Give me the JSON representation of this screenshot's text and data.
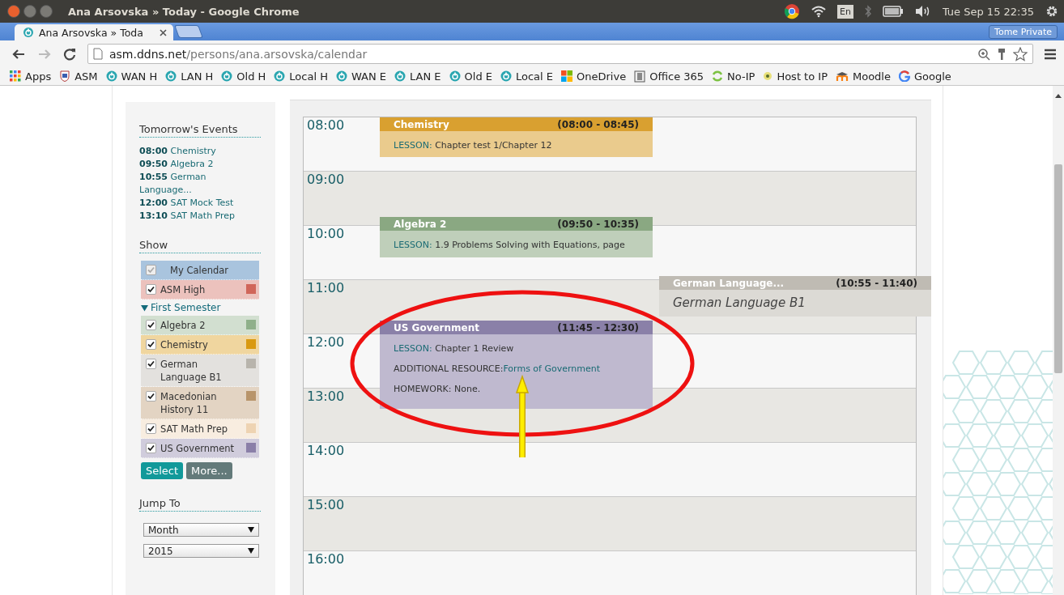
{
  "window": {
    "title": "Ana Arsovska » Today - Google Chrome"
  },
  "tray": {
    "keyboard_layout": "En",
    "clock": "Tue Sep 15 22:35"
  },
  "tabs": [
    {
      "label": "Ana Arsovska » Toda",
      "selected": true
    }
  ],
  "profile_button": "Tome Private",
  "address_bar": {
    "host": "asm.ddns.net",
    "path": "/persons/ana.arsovska/calendar"
  },
  "bookmarks": [
    {
      "label": "Apps",
      "kind": "grid"
    },
    {
      "label": "ASM",
      "kind": "crest"
    },
    {
      "label": "WAN H",
      "kind": "ring"
    },
    {
      "label": "LAN H",
      "kind": "ring"
    },
    {
      "label": "Old H",
      "kind": "ring"
    },
    {
      "label": "Local H",
      "kind": "ring"
    },
    {
      "label": "WAN E",
      "kind": "ring"
    },
    {
      "label": "LAN E",
      "kind": "ring"
    },
    {
      "label": "Old E",
      "kind": "ring"
    },
    {
      "label": "Local E",
      "kind": "ring"
    },
    {
      "label": "OneDrive",
      "kind": "windows"
    },
    {
      "label": "Office 365",
      "kind": "office"
    },
    {
      "label": "No-IP",
      "kind": "sync"
    },
    {
      "label": "Host to IP",
      "kind": "bulb"
    },
    {
      "label": "Moodle",
      "kind": "moodle"
    },
    {
      "label": "Google",
      "kind": "google"
    }
  ],
  "sidebar": {
    "tomorrow": {
      "heading": "Tomorrow's Events",
      "events": [
        {
          "time": "08:00",
          "title": "Chemistry"
        },
        {
          "time": "09:50",
          "title": "Algebra 2"
        },
        {
          "time": "10:55",
          "title": "German Language..."
        },
        {
          "time": "12:00",
          "title": "SAT Mock Test"
        },
        {
          "time": "13:10",
          "title": "SAT Math Prep"
        }
      ]
    },
    "show": {
      "heading": "Show",
      "items": [
        {
          "kind": "primary",
          "label": "My Calendar",
          "checked": true,
          "disabled": true,
          "color": "#a9c4de"
        },
        {
          "kind": "calendar",
          "label": "ASM High",
          "checked": true,
          "disabled": false,
          "color": "#d0665a"
        },
        {
          "kind": "group",
          "label": "First Semester",
          "expanded": true,
          "children": [
            {
              "kind": "calendar",
              "label": "Algebra 2",
              "checked": true,
              "disabled": false,
              "color": "#8fb08a"
            },
            {
              "kind": "calendar",
              "label": "Chemistry",
              "checked": true,
              "disabled": false,
              "color": "#d9990f"
            },
            {
              "kind": "calendar",
              "label": "German Language B1",
              "checked": true,
              "disabled": false,
              "color": "#b8b4ac"
            },
            {
              "kind": "calendar",
              "label": "Macedonian History 11",
              "checked": true,
              "disabled": false,
              "color": "#b8946a"
            },
            {
              "kind": "calendar",
              "label": "SAT Math Prep",
              "checked": true,
              "disabled": false,
              "color": "#eed3b2"
            },
            {
              "kind": "calendar",
              "label": "US Government",
              "checked": true,
              "disabled": false,
              "color": "#8a7fa8"
            }
          ]
        }
      ],
      "buttons": [
        "Select",
        "More..."
      ]
    },
    "jump_to": {
      "heading": "Jump To",
      "selects": [
        "Month",
        "2015"
      ]
    }
  },
  "day_view": {
    "hours": [
      "08:00",
      "09:00",
      "10:00",
      "11:00",
      "12:00",
      "13:00",
      "14:00",
      "15:00",
      "16:00"
    ],
    "events": [
      {
        "title": "Chemistry",
        "time": "(08:00 - 08:45)",
        "color": "#d9a030",
        "lines": [
          {
            "kind": "lesson",
            "label": "LESSON:",
            "text": "Chapter test 1/Chapter 12"
          }
        ]
      },
      {
        "title": "Algebra 2",
        "time": "(09:50 - 10:35)",
        "color": "#8aa882",
        "lines": [
          {
            "kind": "lesson",
            "label": "LESSON:",
            "text": "1.9 Problems Solving with Equations, page"
          }
        ]
      },
      {
        "title": "German Language...",
        "time": "(10:55 - 11:40)",
        "color": "#bfbbb3",
        "lines": [
          {
            "kind": "note",
            "text": "German Language B1"
          }
        ]
      },
      {
        "title": "US Government",
        "time": "(11:45 - 12:30)",
        "color": "#8a80a8",
        "lines": [
          {
            "kind": "lesson",
            "label": "LESSON:",
            "text": "Chapter 1 Review"
          },
          {
            "kind": "resource",
            "label": "ADDITIONAL RESOURCE:",
            "text": "Forms of Government"
          },
          {
            "kind": "homework",
            "label": "HOMEWORK:",
            "text": "None."
          }
        ]
      }
    ]
  }
}
